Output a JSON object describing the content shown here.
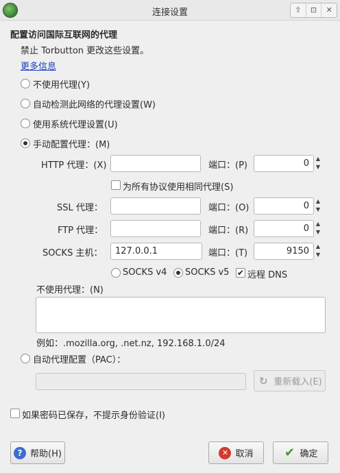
{
  "window": {
    "title": "连接设置",
    "controls": [
      "⇧",
      "⊡",
      "✕"
    ]
  },
  "header": {
    "title": "配置访问国际互联网的代理",
    "note": "禁止 Torbutton 更改这些设置。",
    "more_info": "更多信息"
  },
  "proxy_modes": {
    "none": "不使用代理(Y)",
    "auto_detect": "自动检测此网络的代理设置(W)",
    "system": "使用系统代理设置(U)",
    "manual": "手动配置代理：(M)",
    "selected": "manual"
  },
  "manual": {
    "http_label": "HTTP 代理：(X)",
    "http_host": "",
    "http_port": "0",
    "same_for_all": "为所有协议使用相同代理(S)",
    "ssl_label": "SSL 代理：",
    "ssl_host": "",
    "ssl_port": "0",
    "ftp_label": "FTP 代理：",
    "ftp_host": "",
    "ftp_port": "0",
    "socks_label": "SOCKS 主机：",
    "socks_host": "127.0.0.1",
    "socks_port": "9150",
    "port_label_http": "端口：(P)",
    "port_label_ssl": "端口：(O)",
    "port_label_ftp": "端口：(R)",
    "port_label_socks": "端口：(T)",
    "socks_v4": "SOCKS v4",
    "socks_v5": "SOCKS v5",
    "remote_dns": "远程 DNS",
    "socks_version_selected": "v5",
    "remote_dns_checked": true
  },
  "no_proxy": {
    "label": "不使用代理：(N)",
    "value": "",
    "example": "例如：.mozilla.org, .net.nz, 192.168.1.0/24"
  },
  "pac": {
    "label": "自动代理配置（PAC）：",
    "url": "",
    "reload": "重新载入(E)"
  },
  "auth_option": "如果密码已保存，不提示身份验证(I)",
  "buttons": {
    "help": "帮助(H)",
    "cancel": "取消",
    "ok": "确定"
  },
  "icons": {
    "help": "?",
    "cancel": "✕",
    "ok": "✔",
    "reload": "↻",
    "spin_up": "▲",
    "spin_down": "▼",
    "check": "✔"
  }
}
